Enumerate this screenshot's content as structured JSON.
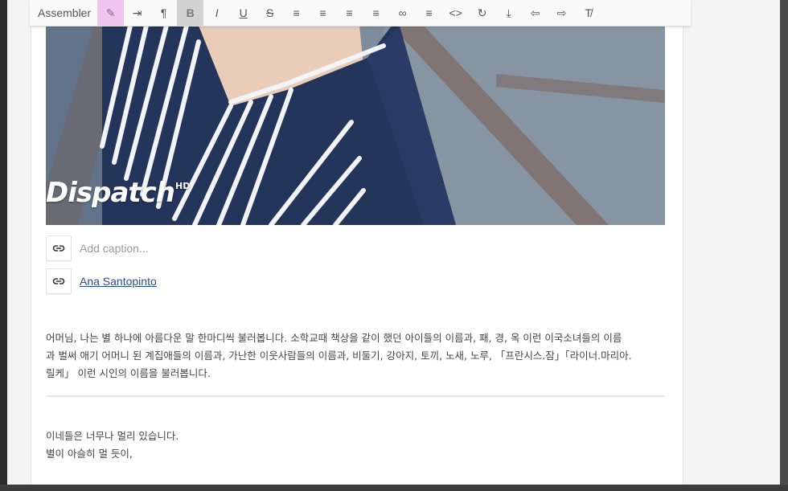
{
  "toolbar": {
    "label": "Assembler",
    "buttons": [
      {
        "name": "highlight-pen-button",
        "icon": "pen-icon",
        "glyph": "✎"
      },
      {
        "name": "indent-button",
        "icon": "indent-icon",
        "glyph": "⇥"
      },
      {
        "name": "paragraph-button",
        "icon": "pilcrow-icon",
        "glyph": "¶"
      },
      {
        "name": "bold-button",
        "icon": "bold-icon",
        "glyph": "B"
      },
      {
        "name": "italic-button",
        "icon": "italic-icon",
        "glyph": "I"
      },
      {
        "name": "underline-button",
        "icon": "underline-icon",
        "glyph": "U"
      },
      {
        "name": "strikethrough-button",
        "icon": "strikethrough-icon",
        "glyph": "S"
      },
      {
        "name": "bulleted-list-button",
        "icon": "bulleted-list-icon",
        "glyph": "≡"
      },
      {
        "name": "numbered-list-button",
        "icon": "numbered-list-icon",
        "glyph": "≡"
      },
      {
        "name": "outdent-button",
        "icon": "outdent-icon",
        "glyph": "≡"
      },
      {
        "name": "indent-block-button",
        "icon": "indent-block-icon",
        "glyph": "≡"
      },
      {
        "name": "link-button",
        "icon": "link-icon",
        "glyph": "∞"
      },
      {
        "name": "align-button",
        "icon": "align-left-icon",
        "glyph": "≡"
      },
      {
        "name": "code-button",
        "icon": "code-icon",
        "glyph": "<>"
      },
      {
        "name": "rotate-button",
        "icon": "rotate-icon",
        "glyph": "↻"
      },
      {
        "name": "download-button",
        "icon": "download-icon",
        "glyph": "⤓"
      },
      {
        "name": "undo-button",
        "icon": "undo-icon",
        "glyph": "⇦"
      },
      {
        "name": "redo-button",
        "icon": "redo-icon",
        "glyph": "⇨"
      },
      {
        "name": "clear-format-button",
        "icon": "clear-format-icon",
        "glyph": "T̸"
      }
    ],
    "active_pink": "#f0c4ee",
    "active_grey": "#d2d2d2"
  },
  "image": {
    "watermark": "Dispatch",
    "watermark_suffix": "HD"
  },
  "caption": {
    "placeholder": "Add caption..."
  },
  "credit": {
    "author": "Ana Santopinto",
    "link_color": "#2a4c8a"
  },
  "article": {
    "paragraph1_line1": "어머님, 나는 별 하나에 아름다운 말 한마디씩 불러봅니다. 소학교때 책상을 같이 했던 아이들의 이름과, 패, 경, 옥 이런 이국소녀들의 이름",
    "paragraph1_line2": "과 벌써 애기 어머니 된 계집애들의 이름과, 가난한 이웃사람들의 이름과, 비둘기, 강아지, 토끼, 노새, 노루, 「프란시스.잠」「라이너.마리아.",
    "paragraph1_line3": "릴케」 이런 시인의 이름을 불러봅니다.",
    "paragraph2_line1": "이네들은 너무나 멀리 있습니다.",
    "paragraph2_line2": "별이 아슬히 멀 듯이,"
  }
}
